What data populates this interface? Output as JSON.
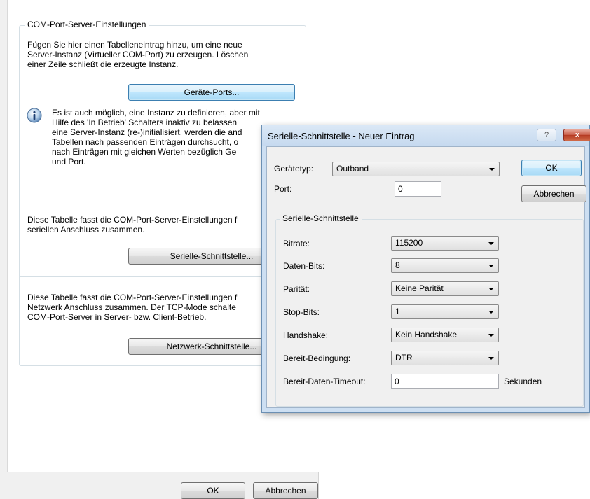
{
  "settings": {
    "group_title": "COM-Port-Server-Einstellungen",
    "intro_line1": "Fügen Sie hier einen Tabelleneintrag hinzu, um eine neue",
    "intro_line2": "Server-Instanz (Virtueller COM-Port) zu erzeugen. Löschen",
    "intro_line3": "einer Zeile schließt die erzeugte Instanz.",
    "device_ports_button": "Geräte-Ports...",
    "info_line1": "Es ist auch möglich, eine Instanz zu definieren, aber mit",
    "info_line2": "Hilfe des 'In Betrieb' Schalters inaktiv zu belassen",
    "info_line3": "eine Server-Instanz (re-)initialisiert, werden die and",
    "info_line4": "Tabellen nach passenden Einträgen durchsucht, o",
    "info_line5": "nach Einträgen mit gleichen Werten bezüglich Ge",
    "info_line6": "und Port.",
    "serial_desc_line1": "Diese Tabelle fasst die COM-Port-Server-Einstellungen f",
    "serial_desc_line2": "seriellen Anschluss zusammen.",
    "serial_button": "Serielle-Schnittstelle...",
    "network_desc_line1": "Diese Tabelle fasst die COM-Port-Server-Einstellungen f",
    "network_desc_line2": "Netzwerk Anschluss zusammen. Der TCP-Mode schalte",
    "network_desc_line3": "COM-Port-Server in Server- bzw. Client-Betrieb.",
    "network_button": "Netzwerk-Schnittstelle...",
    "ok_button": "OK",
    "cancel_button": "Abbrechen"
  },
  "dialog": {
    "title": "Serielle-Schnittstelle - Neuer Eintrag",
    "help_button": "?",
    "close_button": "x",
    "device_type_label": "Gerätetyp:",
    "device_type_value": "Outband",
    "port_label": "Port:",
    "port_value": "0",
    "ok_button": "OK",
    "cancel_button": "Abbrechen",
    "serial_group_title": "Serielle-Schnittstelle",
    "bitrate_label": "Bitrate:",
    "bitrate_value": "115200",
    "databits_label": "Daten-Bits:",
    "databits_value": "8",
    "parity_label": "Parität:",
    "parity_value": "Keine Parität",
    "stopbits_label": "Stop-Bits:",
    "stopbits_value": "1",
    "handshake_label": "Handshake:",
    "handshake_value": "Kein Handshake",
    "ready_condition_label": "Bereit-Bedingung:",
    "ready_condition_value": "DTR",
    "ready_timeout_label": "Bereit-Daten-Timeout:",
    "ready_timeout_value": "0",
    "ready_timeout_unit": "Sekunden"
  },
  "icons": {
    "info": "info-icon",
    "dropdown": "chevron-down-icon"
  },
  "colors": {
    "dialog_frame": "#cddff2",
    "focus_border": "#3c7fb1",
    "close_button": "#c75a45"
  }
}
